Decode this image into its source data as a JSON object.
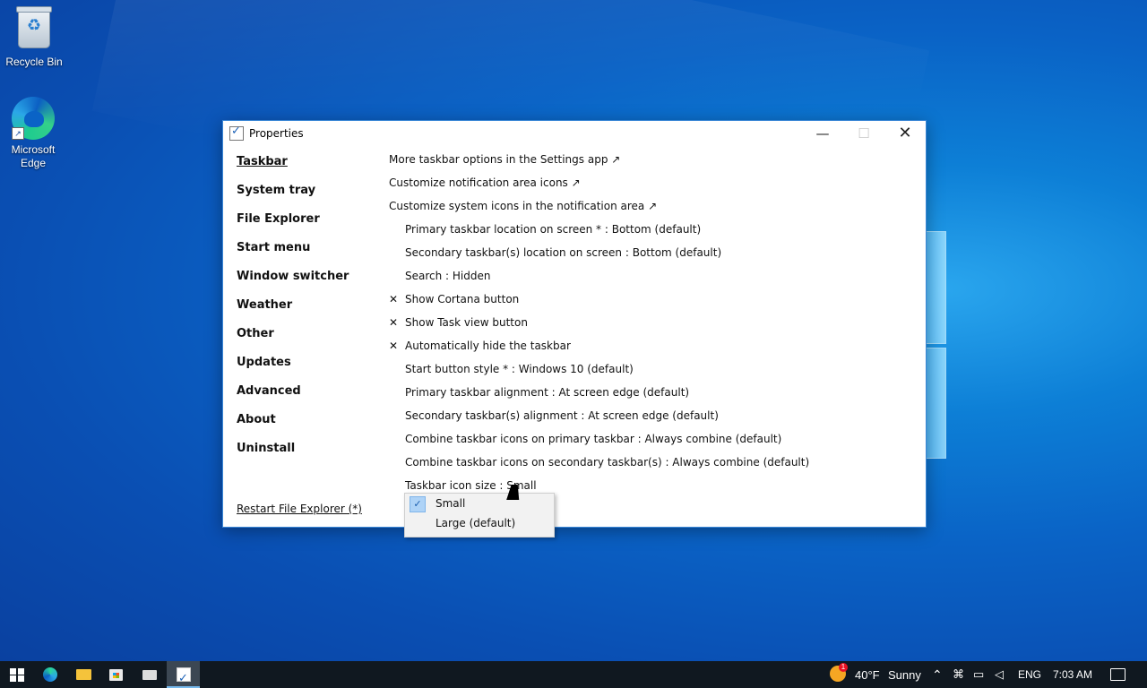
{
  "desktop": {
    "icons": [
      {
        "label": "Recycle Bin"
      },
      {
        "label": "Microsoft Edge"
      }
    ]
  },
  "window": {
    "title": "Properties",
    "min_glyph": "—",
    "max_glyph": "☐",
    "close_glyph": "✕",
    "nav": [
      {
        "label": "Taskbar"
      },
      {
        "label": "System tray"
      },
      {
        "label": "File Explorer"
      },
      {
        "label": "Start menu"
      },
      {
        "label": "Window switcher"
      },
      {
        "label": "Weather"
      },
      {
        "label": "Other"
      },
      {
        "label": "Updates"
      },
      {
        "label": "Advanced"
      },
      {
        "label": "About"
      },
      {
        "label": "Uninstall"
      }
    ],
    "restart_link": "Restart File Explorer (*)",
    "options": [
      {
        "text": "More taskbar options in the Settings app ↗"
      },
      {
        "text": "Customize notification area icons ↗"
      },
      {
        "text": "Customize system icons in the notification area ↗"
      },
      {
        "text": "Primary taskbar location on screen * : Bottom (default)"
      },
      {
        "text": "Secondary taskbar(s) location on screen : Bottom (default)"
      },
      {
        "text": "Search : Hidden"
      },
      {
        "text": "Show Cortana button",
        "mark": "✕"
      },
      {
        "text": "Show Task view button",
        "mark": "✕"
      },
      {
        "text": "Automatically hide the taskbar",
        "mark": "✕"
      },
      {
        "text": "Start button style * : Windows 10 (default)"
      },
      {
        "text": "Primary taskbar alignment : At screen edge (default)"
      },
      {
        "text": "Secondary taskbar(s) alignment : At screen edge (default)"
      },
      {
        "text": "Combine taskbar icons on primary taskbar : Always combine (default)"
      },
      {
        "text": "Combine taskbar icons on secondary taskbar(s) : Always combine (default)"
      },
      {
        "text": "Taskbar icon size : Small"
      }
    ]
  },
  "popup": {
    "items": [
      {
        "label": "Small",
        "checked": true,
        "check_glyph": "✓"
      },
      {
        "label": "Large (default)"
      }
    ]
  },
  "taskbar": {
    "weather_badge": "1",
    "temperature": "40°F",
    "condition": "Sunny",
    "chevron_glyph": "⌃",
    "language": "ENG",
    "time": "7:03 AM"
  }
}
